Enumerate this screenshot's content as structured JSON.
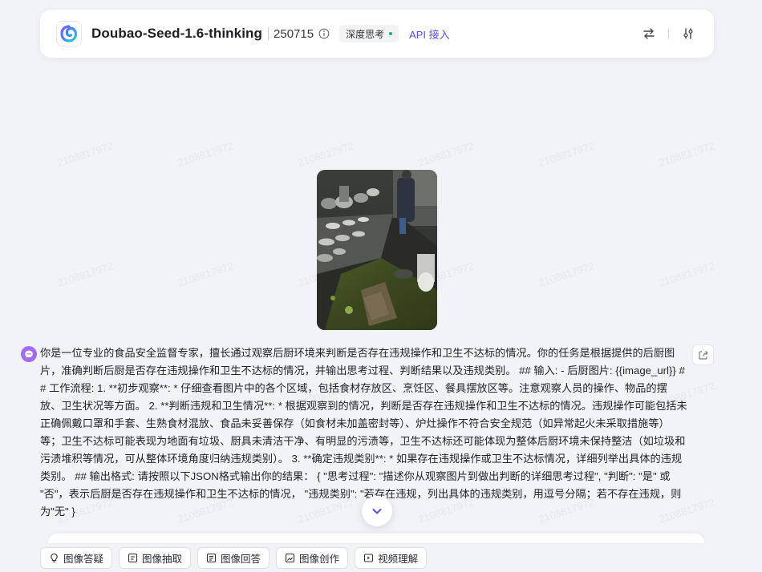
{
  "watermark": "2108817972",
  "header": {
    "model_name": "Doubao-Seed-1.6-thinking",
    "version": "250715",
    "badge": "深度思考",
    "api_link": "API 接入"
  },
  "message": {
    "text": "你是一位专业的食品安全监督专家，擅长通过观察后厨环境来判断是否存在违规操作和卫生不达标的情况。你的任务是根据提供的后厨图片，准确判断后厨是否存在违规操作和卫生不达标的情况，并输出思考过程、判断结果以及违规类别。 ## 输入: - 后厨图片: {{image_url}} ## 工作流程: 1. **初步观察**: * 仔细查看图片中的各个区域，包括食材存放区、烹饪区、餐具摆放区等。注意观察人员的操作、物品的摆放、卫生状况等方面。 2. **判断违规和卫生情况**: * 根据观察到的情况，判断是否存在违规操作和卫生不达标的情况。违规操作可能包括未正确佩戴口罩和手套、生熟食材混放、食品未妥善保存（如食材未加盖密封等）、炉灶操作不符合安全规范（如异常起火未采取措施等）等；卫生不达标可能表现为地面有垃圾、厨具未清洁干净、有明显的污渍等，卫生不达标还可能体现为整体后厨环境未保持整洁（如垃圾和污渍堆积等情况，可从整体环境角度归纳违规类别）。 3. **确定违规类别**: * 如果存在违规操作或卫生不达标情况，详细列举出具体的违规类别。 ## 输出格式: 请按照以下JSON格式输出你的结果： { \"思考过程\": \"描述你从观察图片到做出判断的详细思考过程\", \"判断\": \"是\" 或 \"否\"，表示后厨是否存在违规操作和卫生不达标的情况， \"违规类别\": \"若存在违规，列出具体的违规类别，用逗号分隔；若不存在违规，则为\"无\" }"
  },
  "quick_actions": [
    {
      "label": "图像答疑",
      "icon": "bulb-icon"
    },
    {
      "label": "图像抽取",
      "icon": "extract-icon"
    },
    {
      "label": "图像回答",
      "icon": "answer-icon"
    },
    {
      "label": "图像创作",
      "icon": "create-icon"
    },
    {
      "label": "视频理解",
      "icon": "video-icon"
    }
  ],
  "colors": {
    "accent": "#5b4cf0",
    "background": "#f1f3f7",
    "badge_dot": "#19b36b",
    "avatar": "#a06cf0"
  }
}
